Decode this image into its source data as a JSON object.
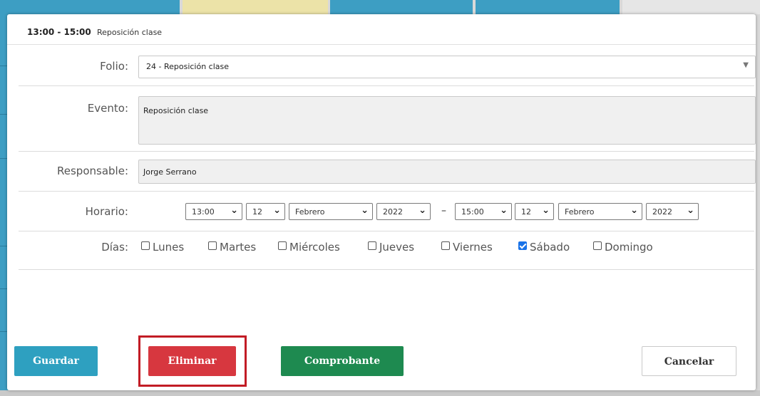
{
  "background": {
    "strip_colors": [
      "#3d9ec3",
      "#ece3a8",
      "#3d9ec3",
      "#3d9ec3",
      "#e6e6e6"
    ]
  },
  "header": {
    "time_range": "13:00 - 15:00",
    "title": "Reposición clase"
  },
  "form": {
    "folio": {
      "label": "Folio:",
      "value": "24 - Reposición clase"
    },
    "evento": {
      "label": "Evento:",
      "value": "Reposición clase"
    },
    "responsable": {
      "label": "Responsable:",
      "value": "Jorge Serrano"
    },
    "horario": {
      "label": "Horario:",
      "start": {
        "hour": "13:00",
        "day": "12",
        "month": "Febrero",
        "year": "2022"
      },
      "separator": "–",
      "end": {
        "hour": "15:00",
        "day": "12",
        "month": "Febrero",
        "year": "2022"
      }
    },
    "dias": {
      "label": "Días:",
      "options": [
        {
          "label": "Lunes",
          "checked": false
        },
        {
          "label": "Martes",
          "checked": false
        },
        {
          "label": "Miércoles",
          "checked": false
        },
        {
          "label": "Jueves",
          "checked": false
        },
        {
          "label": "Viernes",
          "checked": false
        },
        {
          "label": "Sábado",
          "checked": true
        },
        {
          "label": "Domingo",
          "checked": false
        }
      ]
    }
  },
  "buttons": {
    "guardar": "Guardar",
    "eliminar": "Eliminar",
    "comprobante": "Comprobante",
    "cancelar": "Cancelar"
  },
  "colors": {
    "guardar": "#2ea0c0",
    "eliminar": "#d7373f",
    "comprobante": "#1e8a50",
    "highlight": "#c21c25",
    "checkbox_checked": "#1a73e8"
  }
}
